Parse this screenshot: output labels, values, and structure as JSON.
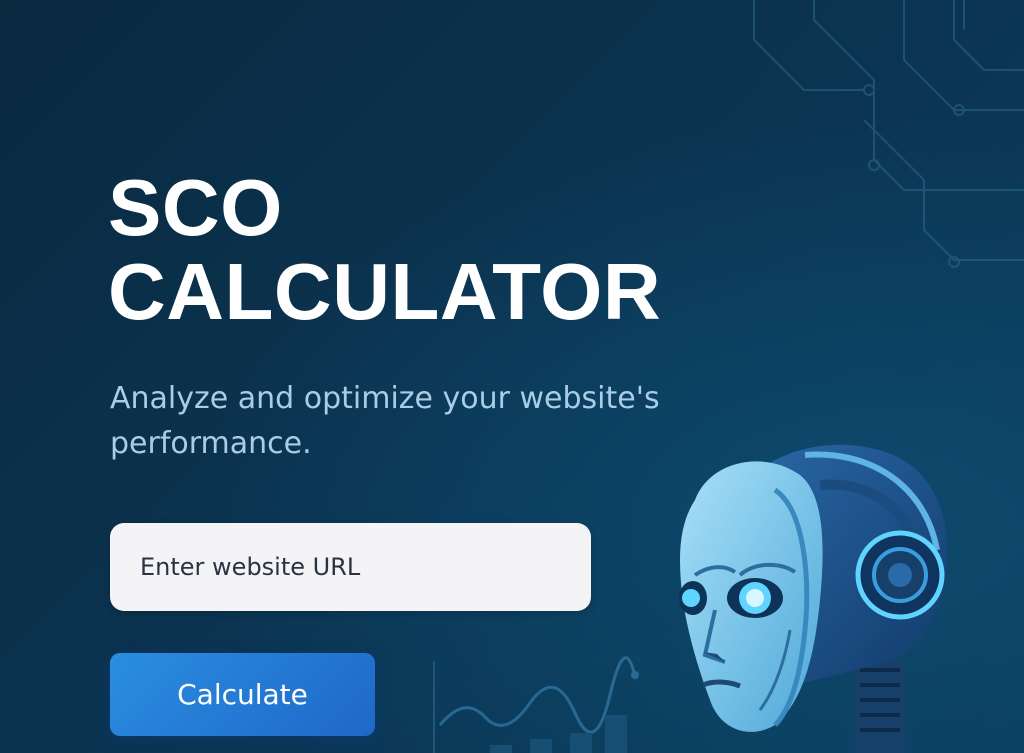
{
  "hero": {
    "title_line1": "SCO",
    "title_line2": "CALCULATOR",
    "subtitle": "Analyze and optimize your website's performance."
  },
  "form": {
    "url_placeholder": "Enter website URL",
    "url_value": "",
    "calculate_label": "Calculate"
  },
  "illustration": {
    "robot_icon": "robot-head-icon",
    "chart_icon": "line-chart-icon",
    "circuit_icon": "circuit-pattern-icon"
  },
  "colors": {
    "background": "#0b3350",
    "accent": "#2a8ee0",
    "subtitle": "#a9cde6",
    "robot_eye": "#5fd4ff"
  }
}
